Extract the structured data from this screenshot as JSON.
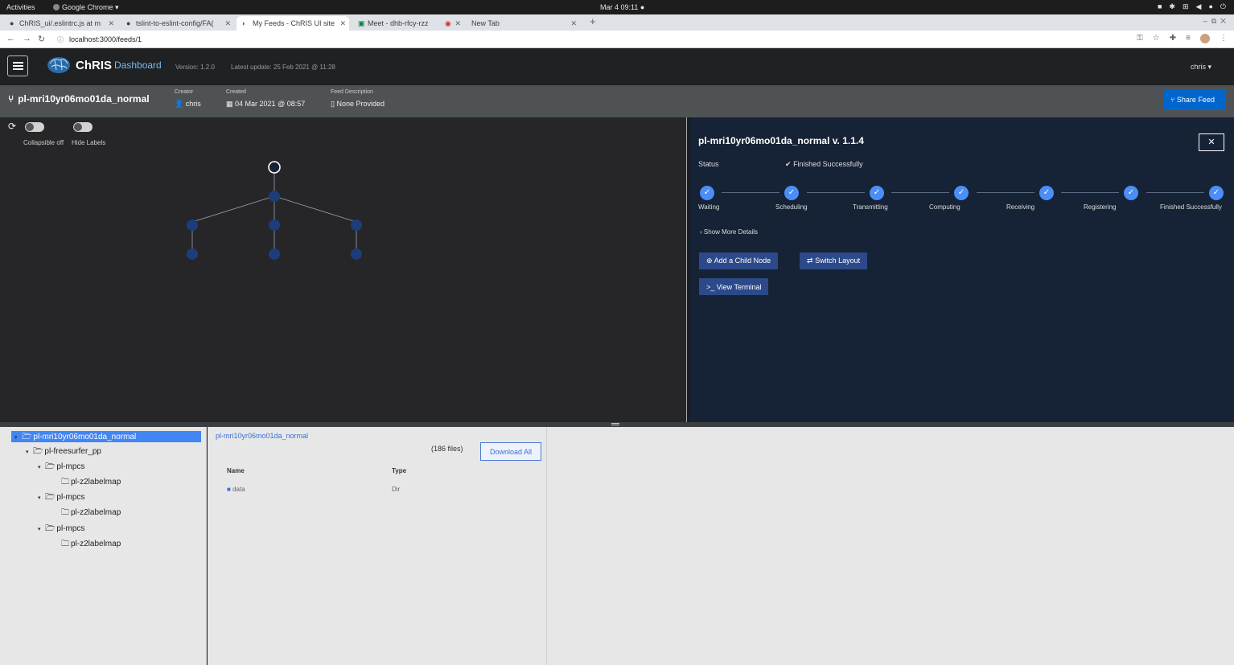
{
  "gnome": {
    "activities": "Activities",
    "app_name": "Google Chrome ▾",
    "clock": "Mar 4  09:11  ●"
  },
  "browser": {
    "tabs": [
      {
        "label": "ChRIS_ui/.eslintrc.js at m",
        "icon": "github-icon"
      },
      {
        "label": "tslint-to-eslint-config/FA(",
        "icon": "github-icon"
      },
      {
        "label": "My Feeds - ChRIS UI site",
        "icon": "chris-icon",
        "active": true
      },
      {
        "label": "Meet - dhb-rfcy-rzz",
        "icon": "meet-icon"
      },
      {
        "label": "New Tab",
        "icon": "record-icon"
      }
    ],
    "url": "localhost:3000/feeds/1"
  },
  "header": {
    "brand": "ChRIS",
    "brand_sub": "Dashboard",
    "version": "Version: 1.2.0",
    "latest_update": "Latest update: 25 Feb 2021 @ 11:28",
    "user": "chris  ▾"
  },
  "feed": {
    "name": "pl-mri10yr06mo01da_normal",
    "creator_label": "Creator",
    "creator": "chris",
    "created_label": "Created",
    "created": "04 Mar 2021 @ 08:57",
    "description_label": "Feed Description",
    "description": "None Provided",
    "share_label": "Share Feed"
  },
  "graph": {
    "toggles": [
      {
        "label": "Collapsible off"
      },
      {
        "label": "Hide Labels"
      }
    ]
  },
  "details": {
    "title": "pl-mri10yr06mo01da_normal v. 1.1.4",
    "status_label": "Status",
    "status_value": "Finished Successfully",
    "steps": [
      "Waiting",
      "Scheduling",
      "Transmitting",
      "Computing",
      "Receiving",
      "Registering",
      "Finished Successfully"
    ],
    "show_more": "Show More Details",
    "add_child": "Add a Child Node",
    "switch_layout": "Switch Layout",
    "view_terminal": "View Terminal",
    "close": "✕"
  },
  "tree": {
    "nodes": [
      {
        "label": "pl-mri10yr06mo01da_normal",
        "depth": 0,
        "selected": true,
        "expandable": true
      },
      {
        "label": "pl-freesurfer_pp",
        "depth": 1,
        "expandable": true
      },
      {
        "label": "pl-mpcs",
        "depth": 2,
        "expandable": true
      },
      {
        "label": "pl-z2labelmap",
        "depth": 3,
        "expandable": false
      },
      {
        "label": "pl-mpcs",
        "depth": 2,
        "expandable": true
      },
      {
        "label": "pl-z2labelmap",
        "depth": 3,
        "expandable": false
      },
      {
        "label": "pl-mpcs",
        "depth": 2,
        "expandable": true
      },
      {
        "label": "pl-z2labelmap",
        "depth": 3,
        "expandable": false
      }
    ]
  },
  "files": {
    "path": "pl-mri10yr06mo01da_normal",
    "count": "(186 files)",
    "download_all": "Download All",
    "columns": [
      "Name",
      "Type"
    ],
    "rows": [
      {
        "name": "data",
        "type": "Dir"
      }
    ]
  }
}
